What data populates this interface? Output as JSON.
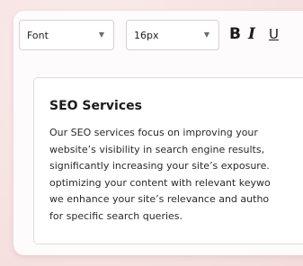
{
  "toolbar": {
    "font_select": {
      "value": "Font",
      "caret_icon": "triangle-down-icon"
    },
    "size_select": {
      "value": "16px",
      "caret_icon": "triangle-down-icon"
    },
    "bold_label": "B",
    "italic_label": "I",
    "underline_label": "U"
  },
  "editor": {
    "title": "SEO Services",
    "lines": [
      "Our SEO services focus on improving your",
      "website’s visibility in search engine results,",
      "significantly increasing your site’s exposure.",
      "optimizing your content with relevant keywo",
      "we enhance your site’s relevance and autho",
      "for specific search queries."
    ]
  },
  "colors": {
    "background": "#f4dcdc",
    "card": "#fdfbfb",
    "text": "#1b1b1b",
    "border": "#d9d3d3"
  }
}
